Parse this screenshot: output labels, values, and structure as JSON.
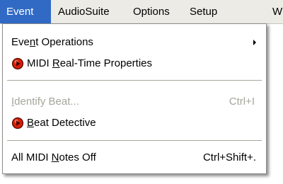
{
  "menubar": {
    "items": [
      {
        "label": "Event",
        "active": true
      },
      {
        "label": "AudioSuite"
      },
      {
        "label": "Options"
      },
      {
        "label": "Setup"
      },
      {
        "label": "W"
      }
    ]
  },
  "event_menu": {
    "items": [
      {
        "label": "Event Operations",
        "mnemonic": "n",
        "submenu": true,
        "enabled": true,
        "icon": "submenu-arrow-icon"
      },
      {
        "label": "MIDI Real-Time Properties",
        "mnemonic": "R",
        "enabled": true,
        "icon": "red-record-icon"
      },
      {
        "label": "Identify Beat...",
        "mnemonic": "I",
        "shortcut": "Ctrl+I",
        "enabled": false
      },
      {
        "label": "Beat Detective",
        "mnemonic": "B",
        "enabled": true,
        "icon": "red-record-icon"
      },
      {
        "label": "All MIDI Notes Off",
        "mnemonic": "N",
        "shortcut": "Ctrl+Shift+.",
        "enabled": true
      }
    ]
  },
  "colors": {
    "menubar_bg": "#ecebe6",
    "highlight": "#316ac5",
    "disabled_text": "#a6a59c",
    "icon_red": "#d81e05"
  }
}
